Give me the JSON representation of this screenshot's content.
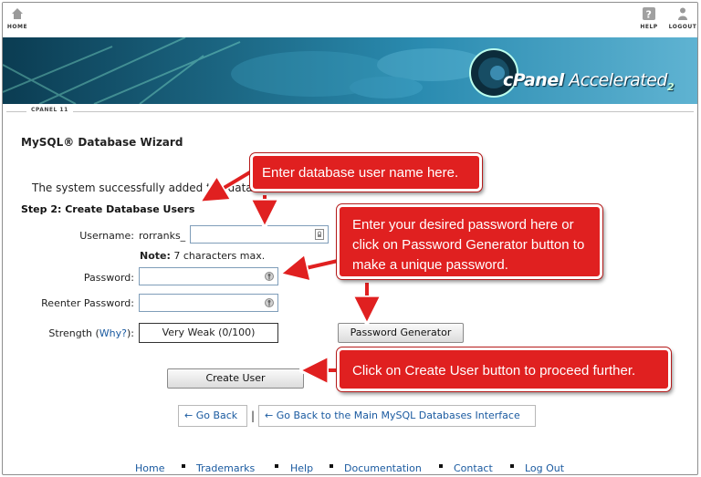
{
  "topnav": {
    "home_label": "HOME",
    "help_label": "HELP",
    "logout_label": "LOGOUT"
  },
  "banner": {
    "brand_left": "cPanel",
    "brand_right": "Accelerated",
    "brand_version": "2"
  },
  "labelbar": {
    "tag": "CPANEL 11"
  },
  "page": {
    "title": "MySQL® Database Wizard",
    "success_text": "The system successfully added the database",
    "step_heading": "Step 2: Create Database Users"
  },
  "form": {
    "username_label": "Username:",
    "username_prefix": "rorranks_",
    "username_value": "",
    "note_bold": "Note:",
    "note_text": " 7 characters max.",
    "password_label": "Password:",
    "password_value": "",
    "repassword_label": "Reenter Password:",
    "repassword_value": "",
    "strength_label_pre": "Strength (",
    "strength_link": "Why?",
    "strength_label_post": "):",
    "strength_value": "Very Weak (0/100)",
    "password_generator_label": "Password Generator",
    "create_user_label": "Create User"
  },
  "navigation": {
    "go_back_label": "← Go Back",
    "separator": "|",
    "go_back_main_label": "← Go Back to the Main MySQL Databases Interface"
  },
  "footer": {
    "links": [
      "Home",
      "Trademarks",
      "Help",
      "Documentation",
      "Contact",
      "Log Out"
    ]
  },
  "callouts": {
    "username_tip": "Enter database user name here.",
    "password_tip": "Enter your desired password here or click on Password Generator button to make a unique password.",
    "create_tip": "Click on Create User button to proceed further."
  },
  "colors": {
    "callout_red": "#e02020",
    "link_blue": "#1a5aa0"
  },
  "icons": {
    "home": "home-icon",
    "help": "help-icon",
    "logout": "logout-icon",
    "password_field": "key-icon"
  }
}
